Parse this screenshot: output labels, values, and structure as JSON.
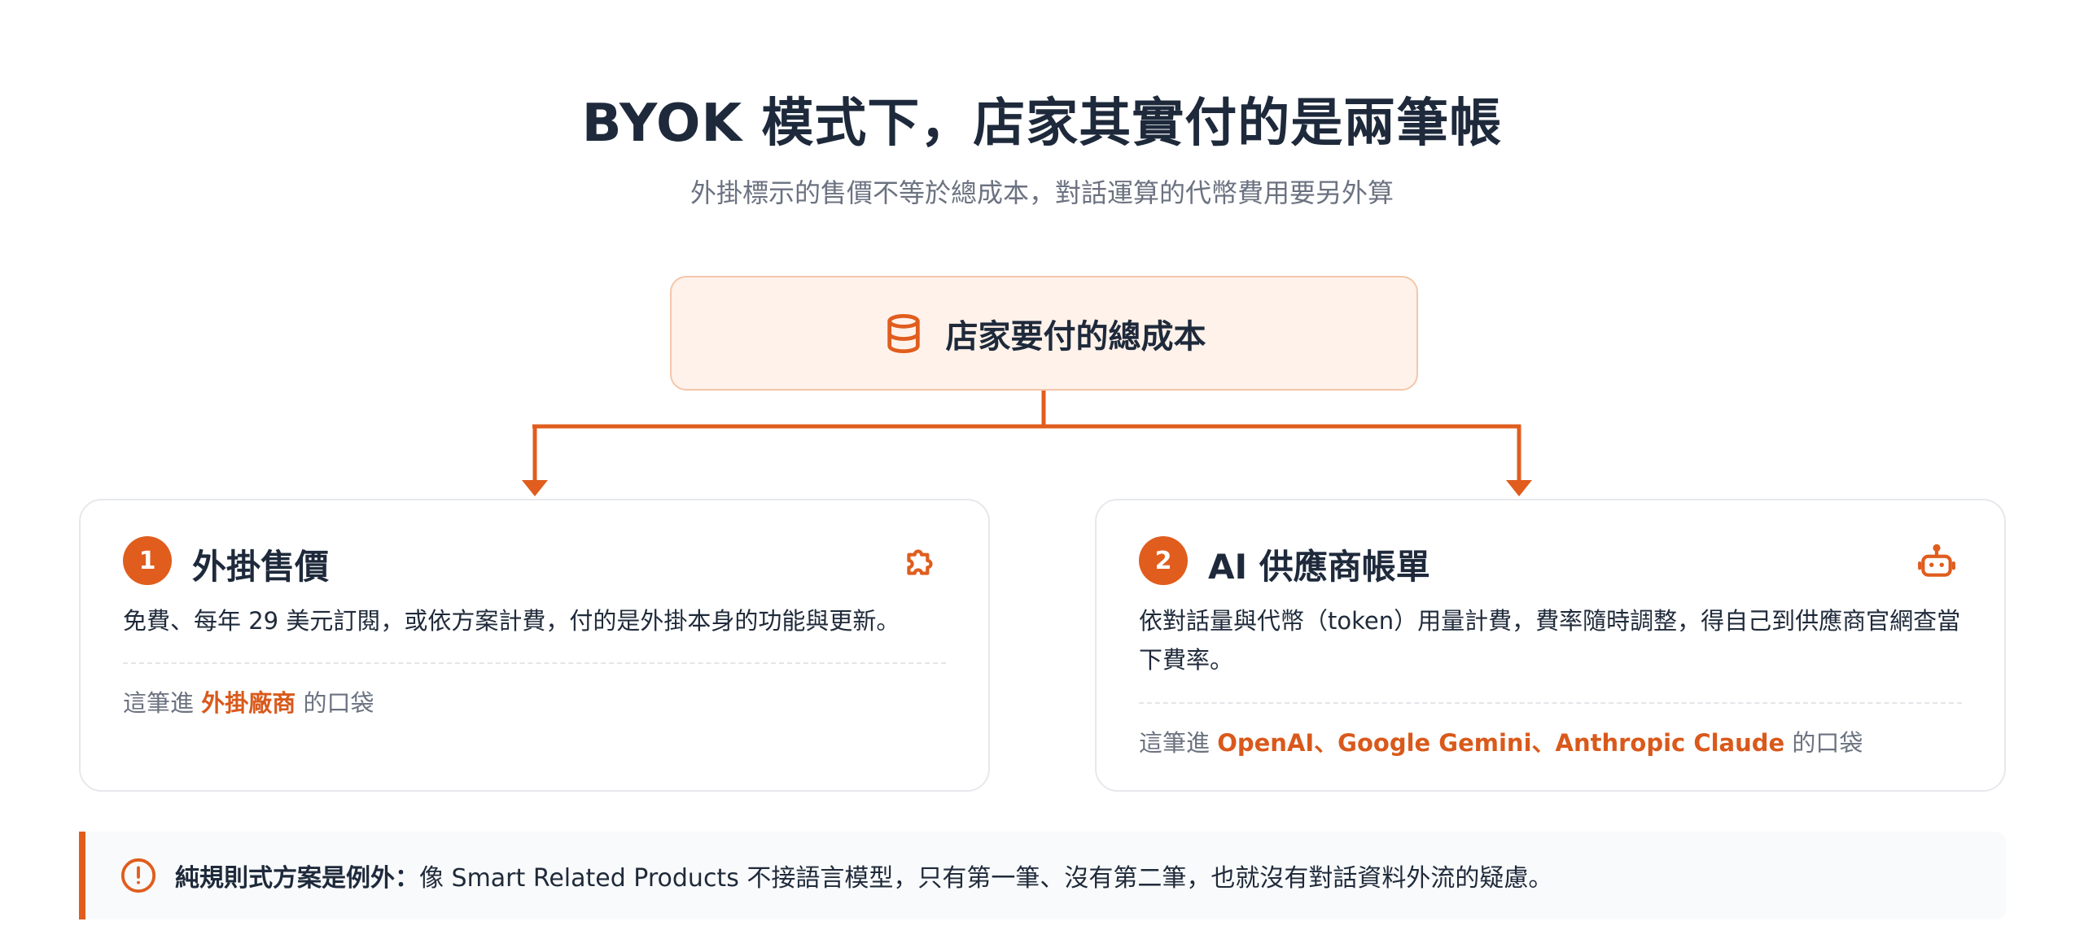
{
  "header": {
    "title": "BYOK 模式下，店家其實付的是兩筆帳",
    "subtitle": "外掛標示的售價不等於總成本，對話運算的代幣費用要另外算"
  },
  "total": {
    "label": "店家要付的總成本",
    "icon": "database-icon"
  },
  "cards": [
    {
      "number": "1",
      "title": "外掛售價",
      "icon": "puzzle-icon",
      "description": "免費、每年 29 美元訂閱，或依方案計費，付的是外掛本身的功能與更新。",
      "pocket_prefix": "這筆進 ",
      "pocket_highlight": "外掛廠商",
      "pocket_suffix": " 的口袋"
    },
    {
      "number": "2",
      "title": "AI 供應商帳單",
      "icon": "robot-icon",
      "description": "依對話量與代幣（token）用量計費，費率隨時調整，得自己到供應商官網查當下費率。",
      "pocket_prefix": "這筆進 ",
      "pocket_highlight": "OpenAI、Google Gemini、Anthropic Claude",
      "pocket_suffix": " 的口袋"
    }
  ],
  "note": {
    "icon": "alert-circle-icon",
    "strong": "純規則式方案是例外：",
    "text": "像 Smart Related Products 不接語言模型，只有第一筆、沒有第二筆，也就沒有對話資料外流的疑慮。"
  },
  "colors": {
    "accent": "#e05d1e",
    "accent_light": "#fff2ea",
    "heading": "#1e2a3b",
    "muted": "#6b7280"
  }
}
